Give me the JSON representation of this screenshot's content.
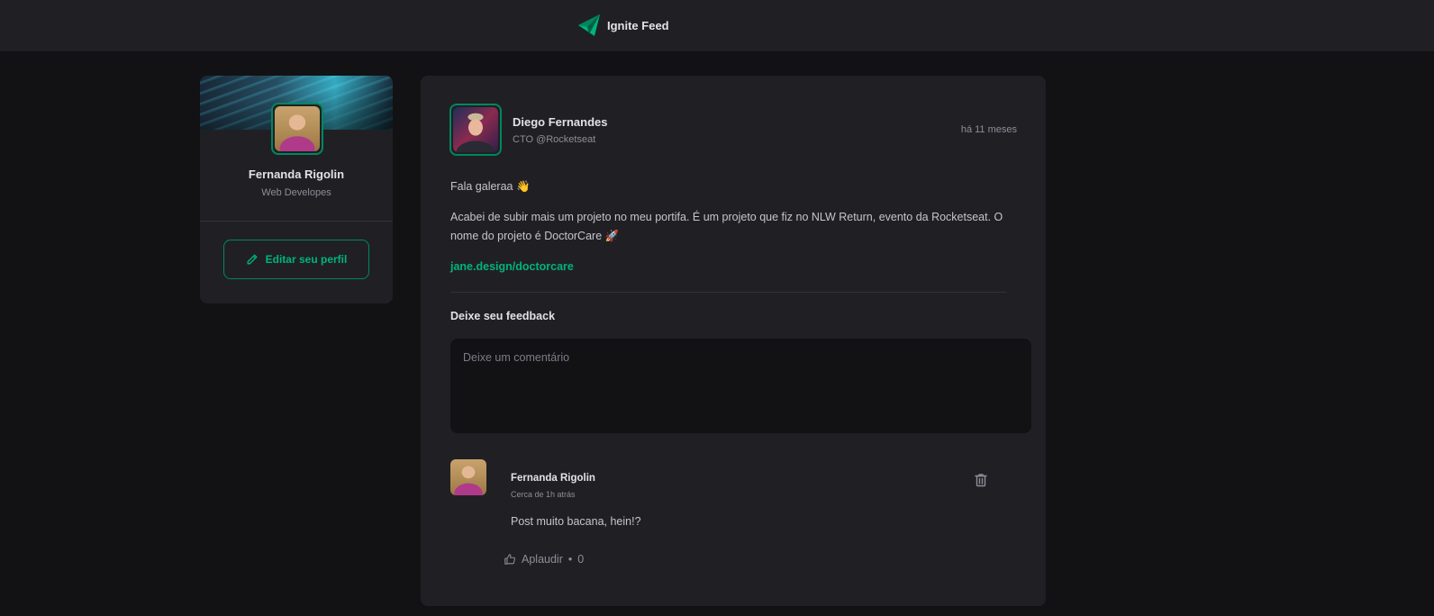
{
  "header": {
    "app_name": "Ignite Feed",
    "logo_icon": "paper-plane-logo-icon",
    "accent": "#00875f"
  },
  "profile": {
    "name": "Fernanda Rigolin",
    "role": "Web Developes",
    "edit_button_label": "Editar seu perfil",
    "edit_icon": "pencil-icon"
  },
  "post": {
    "author_name": "Diego Fernandes",
    "author_role": "CTO @Rocketseat",
    "published": "há 11 meses",
    "paragraphs": [
      "Fala galeraa 👋",
      "Acabei de subir mais um projeto no meu portifa. É um projeto que fiz no NLW Return, evento da Rocketseat. O nome do projeto é DoctorCare 🚀"
    ],
    "link": "jane.design/doctorcare",
    "feedback_title": "Deixe seu feedback",
    "comment_placeholder": "Deixe um comentário"
  },
  "comment": {
    "author": "Fernanda Rigolin",
    "time": "Cerca de 1h atrás",
    "text": "Post muito bacana, hein!?",
    "applaud_label": "Aplaudir",
    "applaud_separator": " • ",
    "applaud_count": "0",
    "delete_icon": "trash-icon",
    "applaud_icon": "thumbs-up-icon"
  },
  "colors": {
    "background": "#121214",
    "card": "#202024",
    "green": "#00b37e",
    "green_dark": "#00875f",
    "text": "#c4c4cc",
    "muted": "#8d8d99"
  }
}
